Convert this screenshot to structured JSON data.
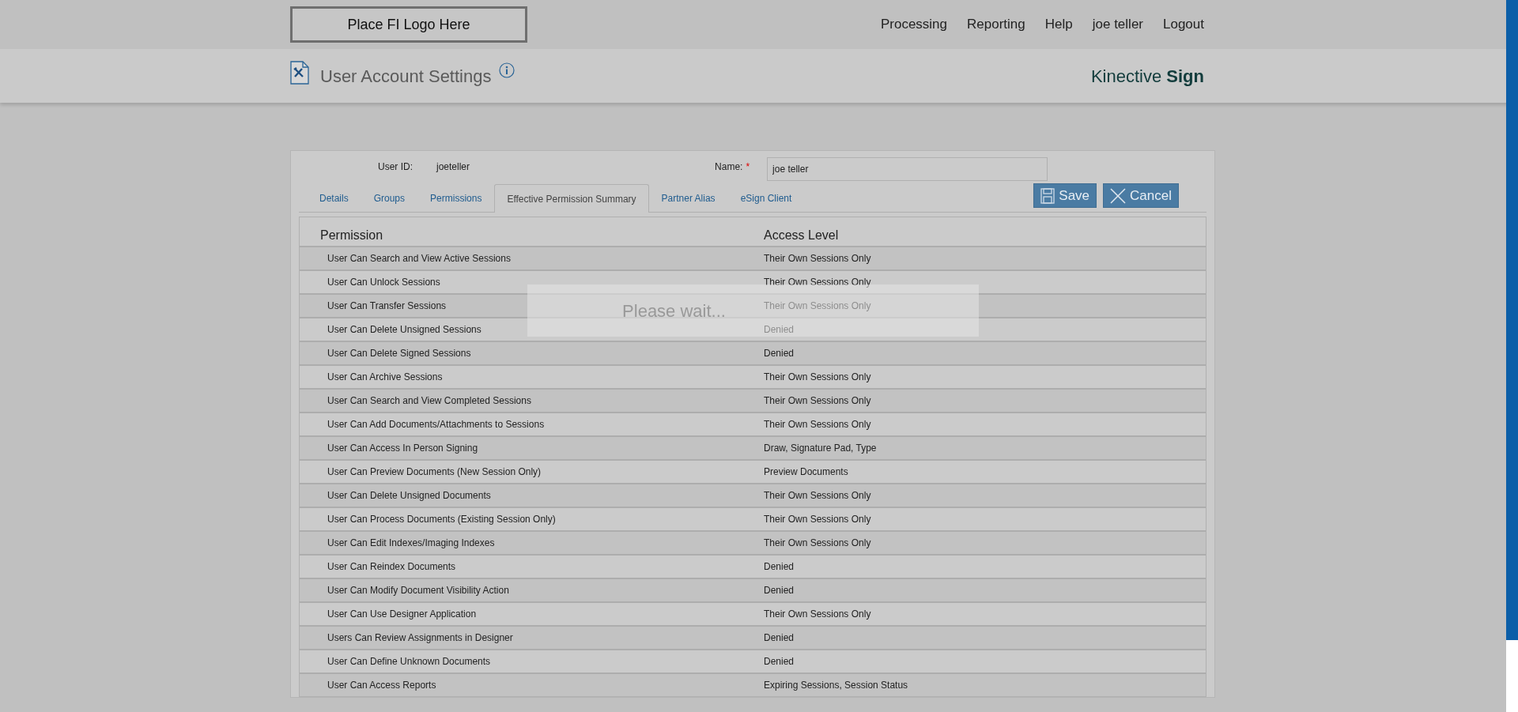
{
  "header": {
    "logo_placeholder": "Place FI Logo Here",
    "nav": [
      "Processing",
      "Reporting",
      "Help",
      "joe teller",
      "Logout"
    ]
  },
  "page_title": {
    "title": "User Account Settings",
    "brand": "Kinective",
    "brand_bold": "Sign"
  },
  "user": {
    "user_id_label": "User ID:",
    "user_id": "joeteller",
    "name_label": "Name:",
    "required_mark": "*",
    "name_value": "joe teller"
  },
  "tabs": [
    {
      "label": "Details",
      "selected": false
    },
    {
      "label": "Groups",
      "selected": false
    },
    {
      "label": "Permissions",
      "selected": false
    },
    {
      "label": "Effective Permission Summary",
      "selected": true
    },
    {
      "label": "Partner Alias",
      "selected": false
    },
    {
      "label": "eSign Client",
      "selected": false
    }
  ],
  "buttons": [
    {
      "label": "Save",
      "kind": "save"
    },
    {
      "label": "Cancel",
      "kind": "cancel"
    }
  ],
  "table": {
    "columns": [
      "Permission",
      "Access Level"
    ],
    "rows": [
      [
        "User Can Search and View Active Sessions",
        "Their Own Sessions Only"
      ],
      [
        "User Can Unlock Sessions",
        "Their Own Sessions Only"
      ],
      [
        "User Can Transfer Sessions",
        "Their Own Sessions Only"
      ],
      [
        "User Can Delete Unsigned Sessions",
        "Denied"
      ],
      [
        "User Can Delete Signed Sessions",
        "Denied"
      ],
      [
        "User Can Archive Sessions",
        "Their Own Sessions Only"
      ],
      [
        "User Can Search and View Completed Sessions",
        "Their Own Sessions Only"
      ],
      [
        "User Can Add Documents/Attachments to Sessions",
        "Their Own Sessions Only"
      ],
      [
        "User Can Access In Person Signing",
        "Draw, Signature Pad, Type"
      ],
      [
        "User Can Preview Documents (New Session Only)",
        "Preview Documents"
      ],
      [
        "User Can Delete Unsigned Documents",
        "Their Own Sessions Only"
      ],
      [
        "User Can Process Documents (Existing Session Only)",
        "Their Own Sessions Only"
      ],
      [
        "User Can Edit Indexes/Imaging Indexes",
        "Their Own Sessions Only"
      ],
      [
        "User Can Reindex Documents",
        "Denied"
      ],
      [
        "User Can Modify Document Visibility Action",
        "Denied"
      ],
      [
        "User Can Use Designer Application",
        "Their Own Sessions Only"
      ],
      [
        "Users Can Review Assignments in Designer",
        "Denied"
      ],
      [
        "User Can Define Unknown Documents",
        "Denied"
      ],
      [
        "User Can Access Reports",
        "Expiring Sessions, Session Status"
      ]
    ]
  },
  "loading": {
    "message": "Please wait..."
  }
}
